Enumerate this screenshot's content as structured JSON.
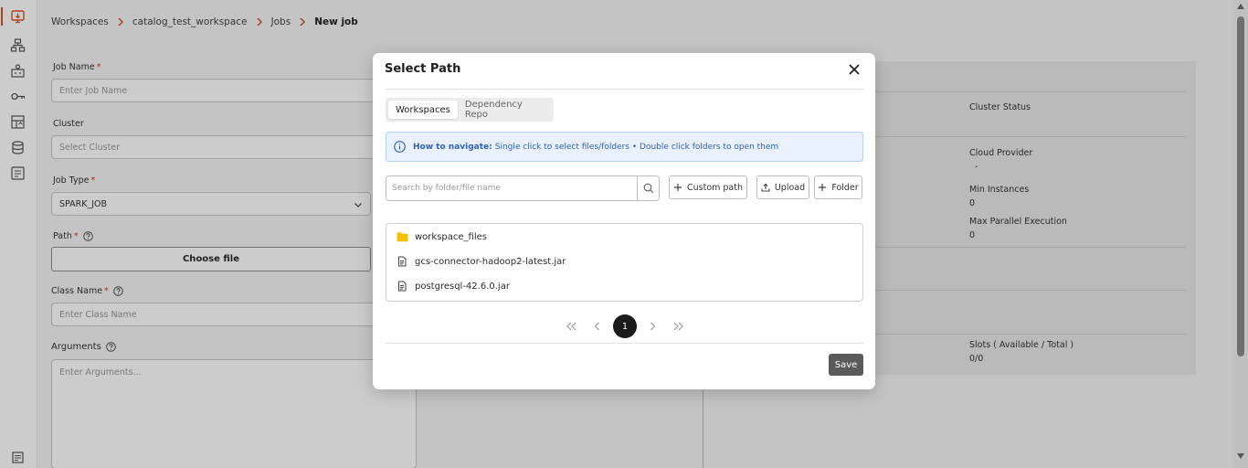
{
  "breadcrumb": [
    "Workspaces",
    "catalog_test_workspace",
    "Jobs",
    "New job"
  ],
  "form": {
    "job_name_label": "Job Name",
    "job_name_placeholder": "Enter Job Name",
    "cluster_label": "Cluster",
    "cluster_placeholder": "Select Cluster",
    "job_type_label": "Job Type",
    "job_type_value": "SPARK_JOB",
    "path_label": "Path",
    "choose_file": "Choose file",
    "class_name_label": "Class Name",
    "class_name_placeholder": "Enter Class Name",
    "arguments_label": "Arguments",
    "arguments_placeholder": "Enter Arguments...",
    "required_mark": "*"
  },
  "cluster_info": {
    "cluster_status_label": "Cluster Status",
    "cloud_provider_label": "Cloud Provider",
    "cloud_provider_value": "-",
    "min_instances_label": "Min Instances",
    "min_instances_value": "0",
    "max_parallel_label": "Max Parallel Execution",
    "max_parallel_value": "0",
    "slots_label": "Slots ( Available / Total )",
    "slots_value": "0/0"
  },
  "modal": {
    "title": "Select Path",
    "tabs": [
      "Workspaces",
      "Dependency Repo"
    ],
    "active_tab": "Workspaces",
    "banner_title": "How to navigate:",
    "banner_text": "Single click to select files/folders • Double click folders to open them",
    "search_placeholder": "Search by folder/file name",
    "custom_path_label": "Custom path",
    "upload_label": "Upload",
    "folder_label": "Folder",
    "files": [
      {
        "name": "workspace_files",
        "type": "folder"
      },
      {
        "name": "gcs-connector-hadoop2-latest.jar",
        "type": "file"
      },
      {
        "name": "postgresql-42.6.0.jar",
        "type": "file"
      }
    ],
    "current_page": "1",
    "save_label": "Save"
  },
  "colors": {
    "accent": "#e0501f",
    "folder": "#f5c000",
    "banner_bg": "#e8f1fd",
    "banner_text": "#2f63b8",
    "save_bg": "#5a5a5a"
  }
}
